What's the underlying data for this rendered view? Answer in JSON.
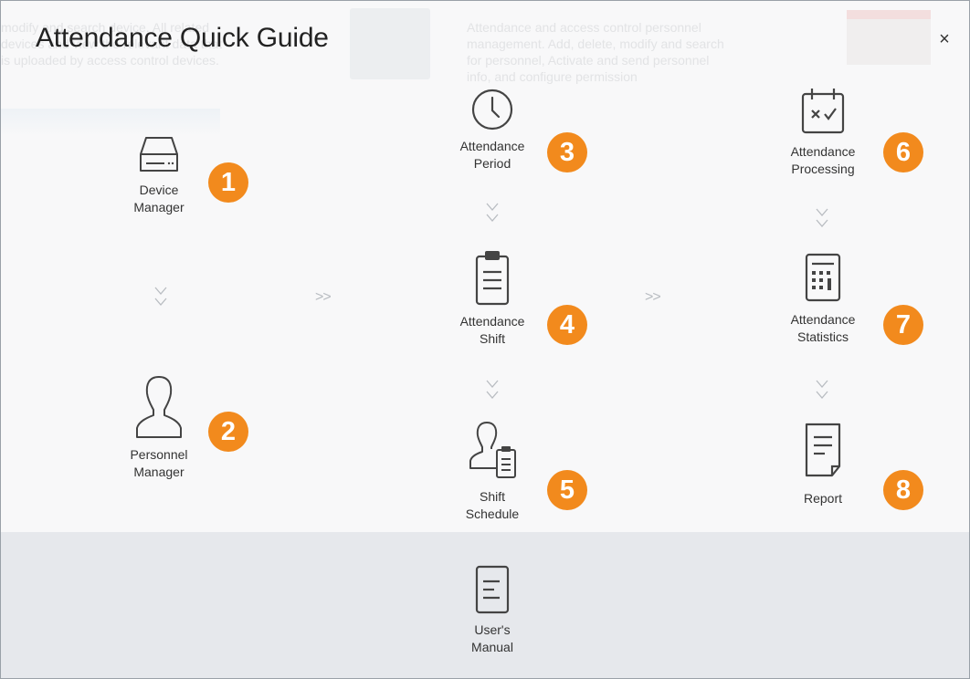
{
  "dialog": {
    "title": "Attendance Quick Guide",
    "close_label": "×"
  },
  "background": {
    "left_text": "modify and search device. All related devices and view the relevant data that is uploaded by access control devices.",
    "center_text": "Attendance and access control personnel management. Add, delete, modify and search for personnel, Activate and send personnel info, and configure permission"
  },
  "steps": [
    {
      "number": "1",
      "label": "Device\nManager",
      "icon": "device-drive-icon"
    },
    {
      "number": "2",
      "label": "Personnel\nManager",
      "icon": "person-icon"
    },
    {
      "number": "3",
      "label": "Attendance\nPeriod",
      "icon": "clock-icon"
    },
    {
      "number": "4",
      "label": "Attendance\nShift",
      "icon": "clipboard-icon"
    },
    {
      "number": "5",
      "label": "Shift\nSchedule",
      "icon": "person-schedule-icon"
    },
    {
      "number": "6",
      "label": "Attendance\nProcessing",
      "icon": "calendar-check-icon"
    },
    {
      "number": "7",
      "label": "Attendance\nStatistics",
      "icon": "calculator-icon"
    },
    {
      "number": "8",
      "label": "Report",
      "icon": "report-document-icon"
    }
  ],
  "flow_arrows": [
    ">>",
    ">>"
  ],
  "manual": {
    "label": "User's\nManual",
    "icon": "manual-document-icon"
  },
  "colors": {
    "badge": "#f28a1d",
    "bottom_band": "#e6e8ec",
    "icon_stroke": "#444444"
  }
}
